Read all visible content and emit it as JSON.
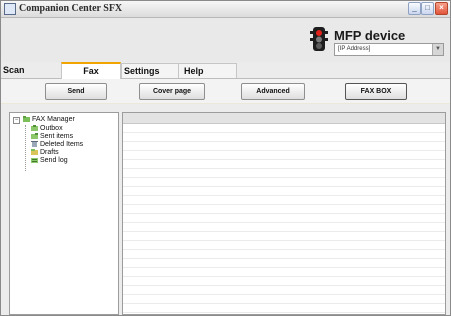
{
  "window": {
    "title": "Companion Center SFX"
  },
  "device": {
    "title": "MFP device",
    "ip_value": "[IP Address]"
  },
  "tabs": [
    {
      "label": "Scan"
    },
    {
      "label": "Fax",
      "active": true
    },
    {
      "label": "Settings"
    },
    {
      "label": "Help"
    }
  ],
  "toolbar": {
    "send_label": "Send",
    "cover_label": "Cover page",
    "advanced_label": "Advanced",
    "faxbox_label": "FAX BOX"
  },
  "tree": {
    "root": "FAX Manager",
    "children": [
      "Outbox",
      "Sent items",
      "Deleted Items",
      "Drafts",
      "Send log"
    ]
  },
  "colors": {
    "active_tab_accent": "#f0a500",
    "window_bg": "#ececec",
    "close_button": "#e0553a"
  },
  "icons": [
    "app-window-icon",
    "minimize-icon",
    "maximize-icon",
    "close-icon",
    "traffic-light-icon",
    "chevron-down-icon",
    "folder-icon",
    "outbox-icon",
    "sent-items-icon",
    "trash-icon",
    "drafts-icon",
    "log-icon"
  ]
}
